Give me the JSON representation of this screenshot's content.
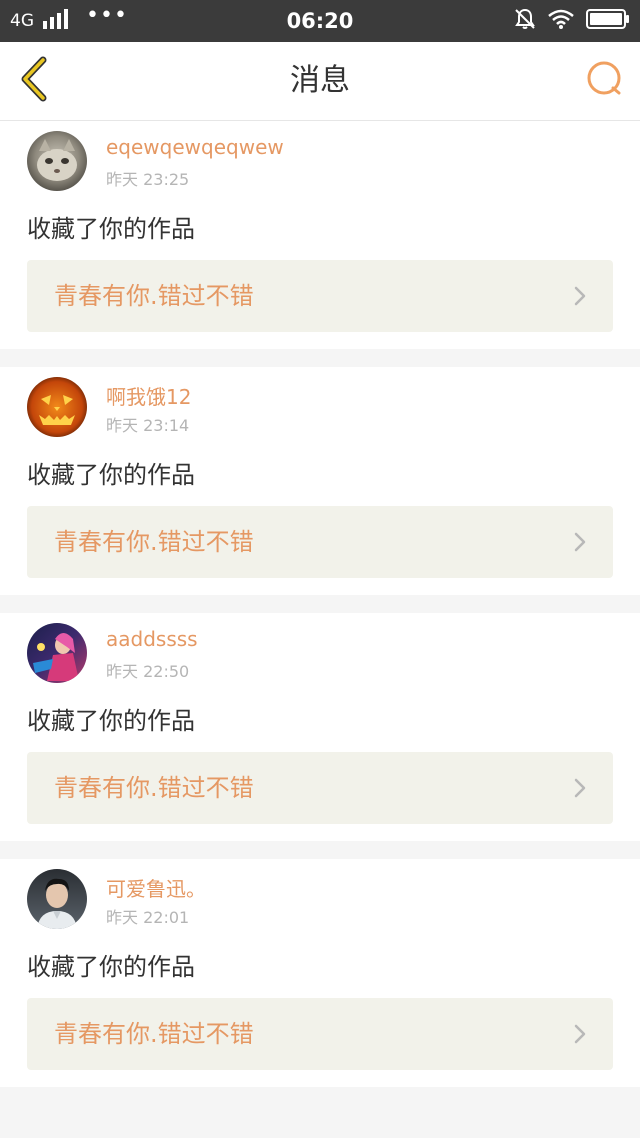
{
  "status_bar": {
    "network": "4G",
    "dots": "•••",
    "time": "06:20"
  },
  "header": {
    "title": "消息"
  },
  "colors": {
    "accent": "#e59863",
    "back_arrow": "#d9b21a",
    "search_icon": "#f0a060"
  },
  "messages": [
    {
      "username": "eqewqewqeqwew",
      "time": "昨天 23:25",
      "action": "收藏了你的作品",
      "work_title": "青春有你.错过不错",
      "avatar_icon": "cat-avatar"
    },
    {
      "username": "啊我饿12",
      "time": "昨天 23:14",
      "action": "收藏了你的作品",
      "work_title": "青春有你.错过不错",
      "avatar_icon": "pumpkin-avatar"
    },
    {
      "username": "aaddssss",
      "time": "昨天 22:50",
      "action": "收藏了你的作品",
      "work_title": "青春有你.错过不错",
      "avatar_icon": "game-character-avatar"
    },
    {
      "username": "可爱鲁迅。",
      "time": "昨天 22:01",
      "action": "收藏了你的作品",
      "work_title": "青春有你.错过不错",
      "avatar_icon": "man-photo-avatar"
    }
  ]
}
